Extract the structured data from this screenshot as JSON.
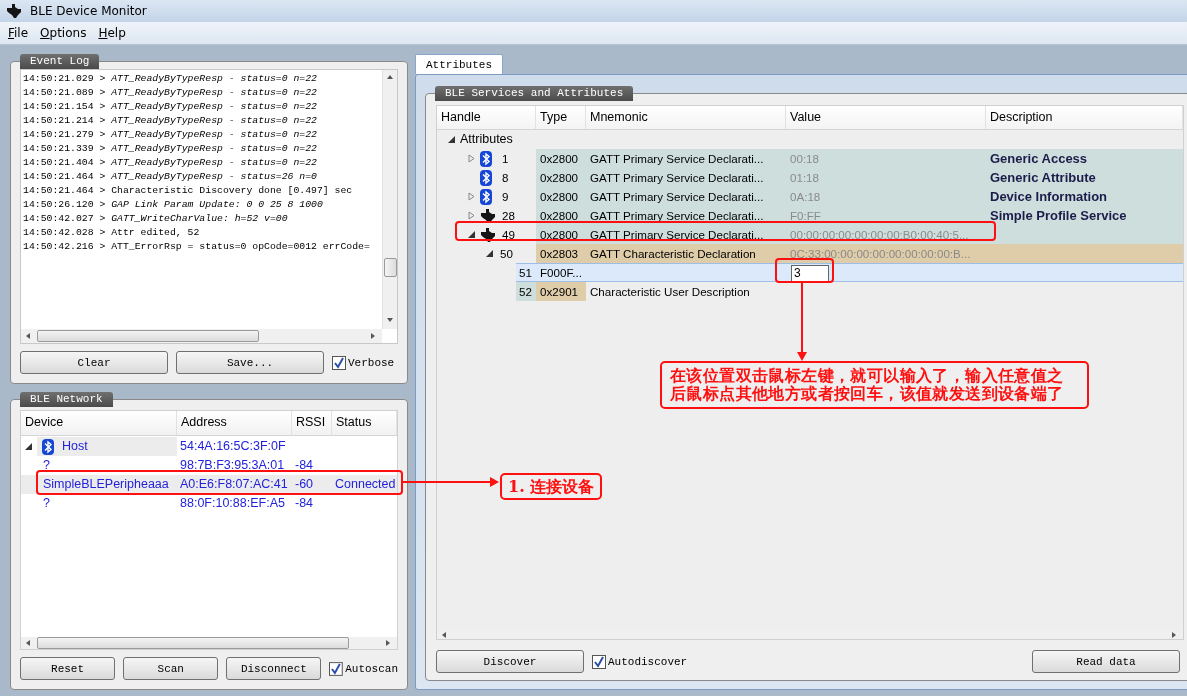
{
  "window": {
    "title": "BLE Device Monitor"
  },
  "menu": [
    {
      "label": "File"
    },
    {
      "label": "Options"
    },
    {
      "label": "Help"
    }
  ],
  "event_log": {
    "title": "Event Log",
    "lines": [
      "14:50:21.029 > *ATT_ReadyByTypeResp - status=0 n=22*",
      "14:50:21.089 > *ATT_ReadyByTypeResp - status=0 n=22*",
      "14:50:21.154 > *ATT_ReadyByTypeResp - status=0 n=22*",
      "14:50:21.214 > *ATT_ReadyByTypeResp - status=0 n=22*",
      "14:50:21.279 > *ATT_ReadyByTypeResp - status=0 n=22*",
      "14:50:21.339 > *ATT_ReadyByTypeResp - status=0 n=22*",
      "14:50:21.404 > *ATT_ReadyByTypeResp - status=0 n=22*",
      "14:50:21.464 > *ATT_ReadyByTypeResp - status=26 n=0*",
      "14:50:21.464 > Characteristic Discovery done [0.497] sec",
      "14:50:26.120 > *GAP Link Param Update: 0 0 25 8 1000*",
      "14:50:42.027 > *GATT_WriteCharValue: h=52 v=00*",
      "14:50:42.028 > Attr edited, 52",
      "14:50:42.216 > ATT_ErrorRsp = status=0 opCode=0012 errCode="
    ],
    "buttons": [
      {
        "label": "Clear"
      },
      {
        "label": "Save..."
      }
    ],
    "verbose": {
      "label": "Verbose",
      "checked": true
    }
  },
  "network": {
    "title": "BLE Network",
    "columns": [
      "Device",
      "Address",
      "RSSI",
      "Status"
    ],
    "rows": [
      {
        "device": "Host",
        "address": "54:4A:16:5C:3F:0F",
        "expanded": true,
        "children": [
          {
            "device": "?",
            "address": "98:7B:F3:95:3A:01",
            "rssi": "-84",
            "selected": false
          },
          {
            "device": "SimpleBLEPeripheaaa",
            "address": "A0:E6:F8:07:AC:41",
            "rssi": "-60",
            "status": "Connected",
            "selected": true
          },
          {
            "device": "?",
            "address": "88:0F:10:88:EF:A5",
            "rssi": "-84",
            "selected": false
          }
        ]
      }
    ],
    "buttons": [
      {
        "label": "Reset"
      },
      {
        "label": "Scan"
      },
      {
        "label": "Disconnect"
      }
    ],
    "autoscan": {
      "label": "Autoscan",
      "checked": true
    }
  },
  "tabs": [
    {
      "label": "Attributes",
      "selected": true
    }
  ],
  "services": {
    "title": "BLE Services and Attributes",
    "columns": [
      "Handle",
      "Type",
      "Mnemonic",
      "Value",
      "Description"
    ],
    "tree": {
      "label": "Attributes",
      "expanded": true,
      "children": [
        {
          "kind": "bt_service",
          "handle": "1",
          "type": "0x2800",
          "mnemonic": "GATT Primary Service Declarati...",
          "value": "00:18",
          "description": "Generic Access",
          "expanded": false,
          "selected": false,
          "editing": false
        },
        {
          "kind": "bt_service",
          "handle": "8",
          "type": "0x2800",
          "mnemonic": "GATT Primary Service Declarati...",
          "value": "01:18",
          "description": "Generic Attribute",
          "selected": false,
          "editing": false
        },
        {
          "kind": "bt_service",
          "handle": "9",
          "type": "0x2800",
          "mnemonic": "GATT Primary Service Declarati...",
          "value": "0A:18",
          "description": "Device Information",
          "expanded": false,
          "selected": false,
          "editing": false
        },
        {
          "kind": "custom_service",
          "handle": "28",
          "type": "0x2800",
          "mnemonic": "GATT Primary Service Declarati...",
          "value": "F0:FF",
          "description": "Simple Profile Service",
          "expanded": false,
          "selected": false,
          "editing": false
        },
        {
          "kind": "custom_service",
          "handle": "49",
          "type": "0x2800",
          "mnemonic": "GATT Primary Service Declarati...",
          "value": "00:00:00:00:00:00:00:B0:00:40:5...",
          "expanded": true,
          "selected": false,
          "editing": false,
          "children": [
            {
              "kind": "characteristic",
              "handle": "50",
              "type": "0x2803",
              "mnemonic": "GATT Characteristic Declaration",
              "value": "0C:33:00:00:00:00:00:00:00:00:B...",
              "expanded": true,
              "selected": false,
              "editing": false,
              "children": [
                {
                  "kind": "value",
                  "handle": "51",
                  "type": "F000F...",
                  "value": "3",
                  "selected": true,
                  "editing": true
                },
                {
                  "kind": "descriptor",
                  "handle": "52",
                  "type": "0x2901",
                  "mnemonic": "Characteristic User Description",
                  "selected": false,
                  "editing": false
                }
              ]
            }
          ]
        }
      ]
    },
    "buttons": [
      {
        "label": "Discover"
      },
      {
        "label": "Read data"
      }
    ],
    "autodiscover": {
      "label": "Autodiscover",
      "checked": true
    }
  },
  "annotations": [
    {
      "text": "在该位置双击鼠标左键，就可以输入了，输入任意值之后鼠标点其他地方或者按回车，该值就发送到设备端了"
    },
    {
      "text": "1. 连接设备"
    }
  ]
}
